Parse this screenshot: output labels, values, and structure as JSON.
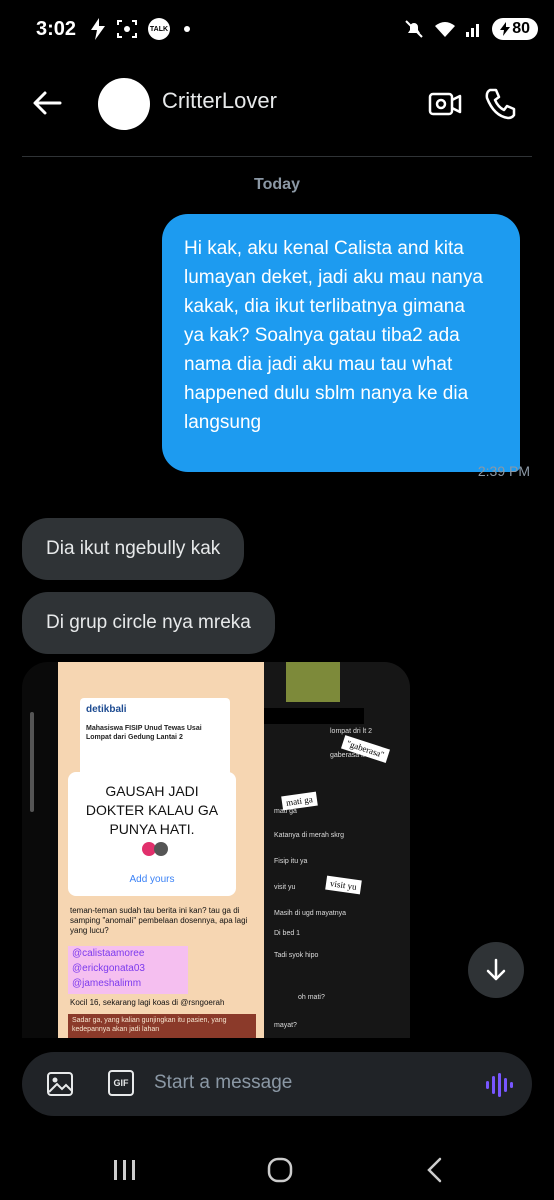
{
  "status_bar": {
    "time": "3:02",
    "talk_badge": "TALK",
    "battery": "80"
  },
  "header": {
    "contact_name": "CritterLover"
  },
  "conversation": {
    "date_separator": "Today",
    "outgoing": {
      "text": "Hi kak, aku kenal Calista and kita lumayan deket, jadi aku mau nanya kakak, dia ikut terlibatnya gimana ya kak? Soalnya gatau tiba2 ada nama dia jadi aku mau tau what happened dulu sblm nanya ke dia langsung",
      "time": "2:39 PM"
    },
    "incoming": [
      {
        "text": "Dia ikut ngebully kak"
      },
      {
        "text": "Di grup circle nya mreka"
      }
    ],
    "media_left": {
      "site": "detikbali",
      "headline": "Mahasiswa FISIP Unud Tewas Usai Lompat dari Gedung Lantai 2",
      "sticker_text": "GAUSAH JADI DOKTER KALAU GA PUNYA HATI.",
      "add_yours": "Add yours",
      "body_text": "teman-teman sudah tau berita ini kan? tau ga di samping \"anomali\" pembelaan dosennya, apa lagi yang lucu?",
      "handles": [
        "@calistaamoree",
        "@erickgonata03",
        "@jameshalimm"
      ],
      "footer_text": "Kocil 16, sekarang lagi koas di @rsngoerah",
      "red_text": "Sadar ga, yang kalian gunjingkan itu pasien, yang kedepannya akan jadi lahan"
    },
    "media_right": {
      "chat_lines": [
        "lompat dri lt 2",
        "gaberasa lt 2 mah",
        "mati ga",
        "Katanya di merah skrg",
        "Fisip itu ya",
        "visit yu",
        "Masih di ugd mayatnya",
        "Di bed 1",
        "Tadi syok hipo",
        "oh mati?",
        "mayat?"
      ],
      "stickers": [
        "\"gaberasa\"",
        "mati ga",
        "visit yu"
      ]
    }
  },
  "composer": {
    "placeholder": "Start a message",
    "gif_label": "GIF"
  },
  "colors": {
    "background": "#000000",
    "outgoing_bubble": "#1d9bf0",
    "incoming_bubble": "#2f3336",
    "composer": "#202327",
    "voice_accent": "#7856ff"
  }
}
